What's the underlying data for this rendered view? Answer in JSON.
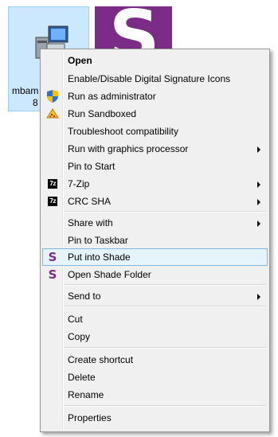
{
  "files": [
    {
      "name_line1": "mbam",
      "name_line2": "8"
    }
  ],
  "shade_tile": {
    "letter": "S",
    "color": "#7b2c86"
  },
  "menu": {
    "items": [
      {
        "label": "Open"
      },
      {
        "label": "Enable/Disable Digital Signature Icons"
      },
      {
        "label": "Run as administrator"
      },
      {
        "label": "Run Sandboxed"
      },
      {
        "label": "Troubleshoot compatibility"
      },
      {
        "label": "Run with graphics processor"
      },
      {
        "label": "Pin to Start"
      },
      {
        "label": "7-Zip"
      },
      {
        "label": "CRC SHA"
      },
      {
        "label": "Share with"
      },
      {
        "label": "Pin to Taskbar"
      },
      {
        "label": "Put into Shade"
      },
      {
        "label": "Open Shade Folder"
      },
      {
        "label": "Send to"
      },
      {
        "label": "Cut"
      },
      {
        "label": "Copy"
      },
      {
        "label": "Create shortcut"
      },
      {
        "label": "Delete"
      },
      {
        "label": "Rename"
      },
      {
        "label": "Properties"
      }
    ],
    "icons": {
      "zip_text": "7z",
      "crc_text": "7z",
      "shade_text": "S"
    }
  }
}
